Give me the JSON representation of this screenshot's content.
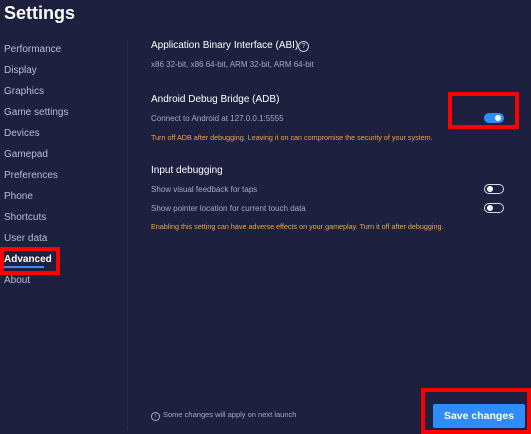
{
  "page": {
    "title": "Settings"
  },
  "sidebar": {
    "items": [
      {
        "label": "Performance"
      },
      {
        "label": "Display"
      },
      {
        "label": "Graphics"
      },
      {
        "label": "Game settings"
      },
      {
        "label": "Devices"
      },
      {
        "label": "Gamepad"
      },
      {
        "label": "Preferences"
      },
      {
        "label": "Phone"
      },
      {
        "label": "Shortcuts"
      },
      {
        "label": "User data"
      },
      {
        "label": "Advanced"
      },
      {
        "label": "About"
      }
    ],
    "active": "Advanced"
  },
  "abi": {
    "title": "Application Binary Interface (ABI)",
    "info_icon": "?",
    "value": "x86 32-bit, x86 64-bit, ARM 32-bit, ARM 64-bit"
  },
  "adb": {
    "title": "Android Debug Bridge (ADB)",
    "connect_text": "Connect to Android at 127.0.0.1:5555",
    "toggle_on": true,
    "warning": "Turn off ADB after debugging. Leaving it on can compromise the security of your system."
  },
  "input_debugging": {
    "title": "Input debugging",
    "taps_label": "Show visual feedback for taps",
    "taps_on": false,
    "pointer_label": "Show pointer location for current touch data",
    "pointer_on": false,
    "warning": "Enabling this setting can have adverse effects on your gameplay. Turn it off after debugging."
  },
  "footer": {
    "info_icon": "i",
    "note": "Some changes will apply on next launch",
    "save_label": "Save changes"
  },
  "colors": {
    "background": "#1e2040",
    "accent": "#2f8cff",
    "warning": "#f0a43a",
    "highlight": "#ff0000"
  }
}
